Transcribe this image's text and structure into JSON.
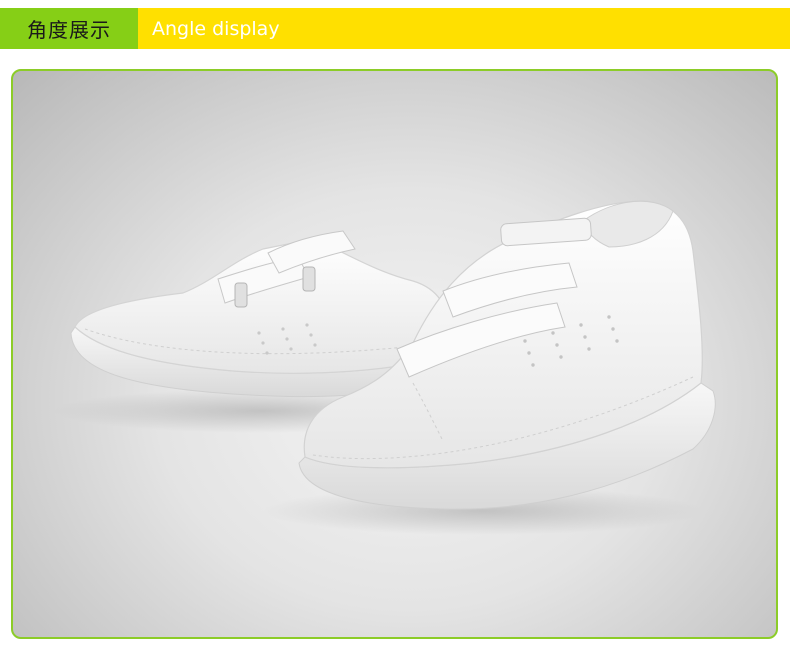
{
  "header": {
    "title_zh": "角度展示",
    "title_en": "Angle display",
    "accent_green": "#86cf16",
    "accent_yellow": "#ffe000"
  },
  "photo": {
    "subject": "shoes-image",
    "frame_color": "#8ccc28"
  }
}
